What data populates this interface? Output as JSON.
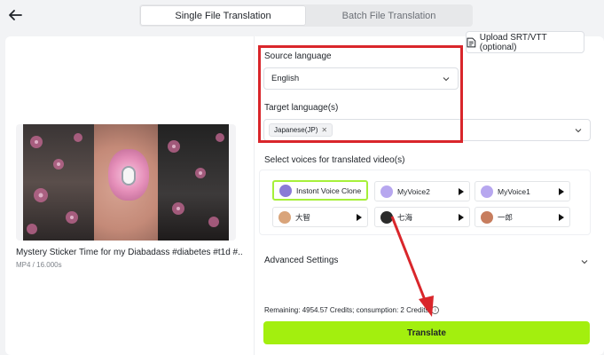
{
  "header": {
    "back_icon": "arrow-left-icon",
    "tabs": [
      {
        "label": "Single File Translation",
        "active": true
      },
      {
        "label": "Batch File Translation",
        "active": false
      }
    ]
  },
  "video": {
    "title": "Mystery Sticker Time for my Diabadass #diabetes #t1d #...",
    "meta": "MP4 / 16.000s"
  },
  "source_language": {
    "label": "Source language",
    "value": "English"
  },
  "upload": {
    "label": "Upload SRT/VTT (optional)",
    "icon": "document-icon"
  },
  "target_language": {
    "label": "Target language(s)",
    "chips": [
      "Japanese(JP)"
    ]
  },
  "voices": {
    "label": "Select voices for translated video(s)",
    "items": [
      {
        "name": "Instont Voice Clone",
        "selected": true,
        "avatar_color": "#8a7bd6"
      },
      {
        "name": "MyVoice2",
        "selected": false,
        "avatar_color": "#b7a7ef"
      },
      {
        "name": "MyVoice1",
        "selected": false,
        "avatar_color": "#b7a7ef"
      },
      {
        "name": "大智",
        "selected": false,
        "avatar_color": "#d9a47a"
      },
      {
        "name": "七海",
        "selected": false,
        "avatar_color": "#2b2b2b"
      },
      {
        "name": "一郎",
        "selected": false,
        "avatar_color": "#c77d5e"
      }
    ]
  },
  "advanced": {
    "label": "Advanced Settings"
  },
  "credits": {
    "text": "Remaining: 4954.57 Credits; consumption: 2 Credits"
  },
  "translate_button": {
    "label": "Translate",
    "color": "#a3ef0e"
  },
  "annotation": {
    "box_color": "#d9262b",
    "arrow_color": "#d9262b"
  }
}
